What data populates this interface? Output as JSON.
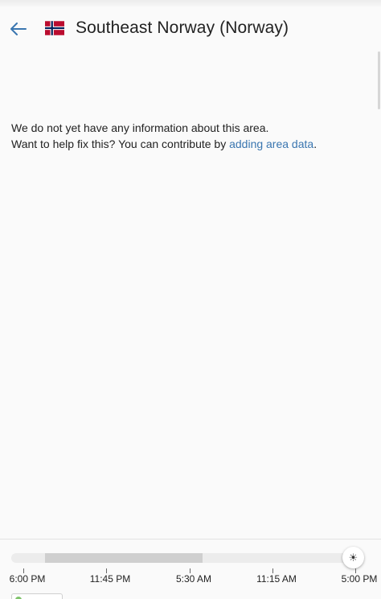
{
  "header": {
    "title": "Southeast Norway (Norway)",
    "back_icon": "arrow-left-icon",
    "flag_icon": "norway-flag-icon"
  },
  "content": {
    "line1": "We do not yet have any information about this area.",
    "line2_prefix": "Want to help fix this? You can contribute by ",
    "link_text": "adding area data",
    "line2_suffix": "."
  },
  "timeline": {
    "ticks": [
      "6:00 PM",
      "11:45 PM",
      "5:30 AM",
      "11:15 AM",
      "5:00 PM"
    ],
    "selected_range": [
      0.1,
      0.57
    ],
    "handle_icon": "sun-icon",
    "handle_glyph": "☀"
  },
  "colors": {
    "link": "#3a76b0",
    "back_arrow": "#3a76b0",
    "flag_red": "#ba0c2f",
    "flag_blue": "#00205b"
  }
}
